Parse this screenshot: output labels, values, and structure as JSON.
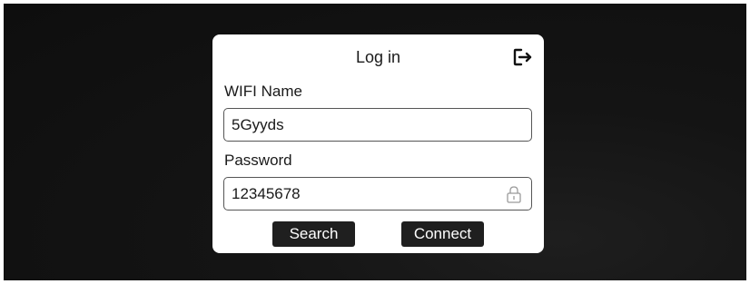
{
  "dialog": {
    "title": "Log in",
    "logout_icon": "logout-icon"
  },
  "wifi": {
    "label": "WIFI Name",
    "value": "5Gyyds"
  },
  "password": {
    "label": "Password",
    "value": "12345678",
    "icon": "lock-icon"
  },
  "buttons": {
    "search_label": "Search",
    "connect_label": "Connect"
  },
  "colors": {
    "background": "#111111",
    "dialog": "#ffffff",
    "button": "#1f1f1f",
    "button_text": "#ffffff"
  }
}
